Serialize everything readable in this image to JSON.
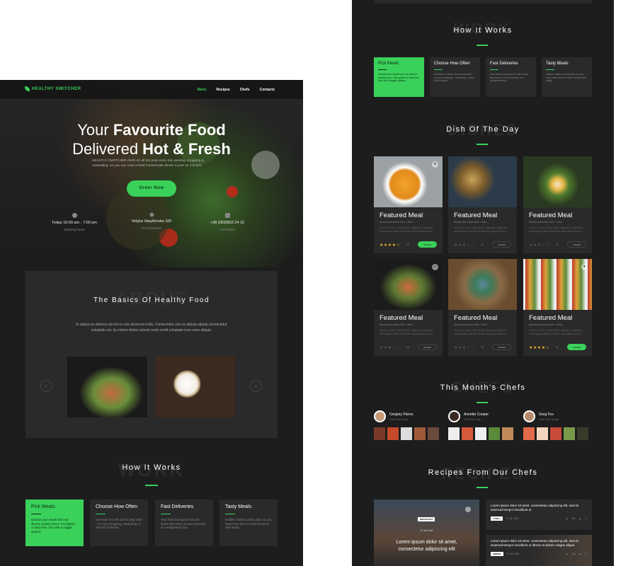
{
  "brand": {
    "name": "HEALTHY SWITCHER",
    "accent": "#3ad15a"
  },
  "nav": {
    "items": [
      "Menu",
      "Recipes",
      "Chefs",
      "Contacts"
    ],
    "active": "Menu"
  },
  "hero": {
    "line1_normal": "Your ",
    "line1_bold": "Favourite Food",
    "line2_normal": "Delivered ",
    "line2_bold": "Hot & Fresh",
    "text": "HEALTHY SWITCHER chefs do all the prep work, like peeling, chopping & marinating, so you can cook a fresh homemade dinner in just 15 minutes.",
    "button": "Order Now",
    "info": [
      {
        "icon": "clock-icon",
        "title": "Today 10:00 am - 7:00 pm",
        "sub": "Working hours"
      },
      {
        "icon": "location-icon",
        "title": "Velyka Vasylkivska 100",
        "sub": "Get Directions"
      },
      {
        "icon": "phone-icon",
        "title": "+38 (063)833 24 15",
        "sub": "Call Online"
      }
    ]
  },
  "about": {
    "bg_word": "ABOUT",
    "title": "The Basics Of Healthy Food",
    "text": "In aliqua ea ullamco ad est ex non deserunt nulla. Consectetur sint ea aliquip aliquip consectetur voluptate est. Eu minim dolore laboris enim mollit voluptate irure esse aliquip."
  },
  "how": {
    "bg_word": "WORK",
    "title": "How It Works",
    "cards": [
      {
        "title": "Pick Meals",
        "text": "Choose your meals from our diverse weekly menu. Find gluten or dairy free, low carb & veggie options.",
        "active": true
      },
      {
        "title": "Choose How Often",
        "text": "Our team of chefs do the prep work - no more chopping, measuring, or sink-full of dishes!",
        "active": false
      },
      {
        "title": "Fast Deliveries",
        "text": "Your fresh & prepared 15 min dinner kits arrive on your doorstep in a refrigerated box.",
        "active": false
      },
      {
        "title": "Tasty Meals",
        "text": "Gobble makes cooking fast, so you have more time to unwind and be with family.",
        "active": false
      }
    ]
  },
  "dishes": {
    "bg_word": "DISHES",
    "title": "Dish Of The Day",
    "items": [
      {
        "title": "Featured Meal",
        "sub": "Served with french fries + drink",
        "text": "Choice of: Coke, Fanta, Sprite, Upgrade to large fries, Add whopper patty, Add Tender crisp patty and more...",
        "rating": "★★★★☆",
        "count": "13",
        "order": "ORDER",
        "green": true
      },
      {
        "title": "Featured Meal",
        "sub": "Served with french fries + drink",
        "text": "Choice of: Coke, Fanta, Sprite, Upgrade to large fries, Add whopper patty, Add Tender crisp patty and more...",
        "rating": "★★★☆☆",
        "count": "13",
        "order": "ORDER",
        "green": false
      },
      {
        "title": "Featured Meal",
        "sub": "Served with french fries + drink",
        "text": "Choice of: Coke, Fanta, Sprite, Upgrade to large fries, Add whopper patty, Add Tender crisp patty and more...",
        "rating": "★★★☆☆",
        "count": "13",
        "order": "ORDER",
        "green": false
      },
      {
        "title": "Featured Meal",
        "sub": "Served with french fries + drink",
        "text": "Choice of: Coke, Fanta, Sprite, Upgrade to large fries, Add whopper patty, Add Tender crisp patty and more...",
        "rating": "★★★☆☆",
        "count": "13",
        "order": "ORDER",
        "green": false
      },
      {
        "title": "Featured Meal",
        "sub": "Served with french fries + drink",
        "text": "Choice of: Coke, Fanta, Sprite, Upgrade to large fries, Add whopper patty, Add Tender crisp patty and more...",
        "rating": "★★★☆☆",
        "count": "13",
        "order": "ORDER",
        "green": false
      },
      {
        "title": "Featured Meal",
        "sub": "Served with french fries + drink",
        "text": "Choice of: Coke, Fanta, Sprite, Upgrade to large fries, Add whopper patty, Add Tender crisp patty and more...",
        "rating": "★★★★☆",
        "count": "11",
        "order": "ORDER",
        "green": true
      }
    ]
  },
  "chefs": {
    "bg_word": "CHEFS",
    "title": "This Month's Chefs",
    "items": [
      {
        "name": "Gregory Flores",
        "role": "Chef of the week"
      },
      {
        "name": "Annette Cooper",
        "role": "Chef of the day"
      },
      {
        "name": "Greg Fox",
        "role": "Chef of the month"
      }
    ]
  },
  "recipes": {
    "bg_word": "RECIPES",
    "title": "Recipes From Our Chefs",
    "big": {
      "tag": "BREAKFAST",
      "date": "27 Jan 2018",
      "title": "Lorem ipsum dolor sit amet, consectetur adipiscing elit"
    },
    "small": [
      {
        "title": "Lorem ipsum dolor sit amet, consectetur adipiscing elit, sed do eiusmod tempor incididunt ut",
        "tag": "LUNCH",
        "date": "27 Jan 2018",
        "views": "105",
        "comments": "11"
      },
      {
        "title": "Lorem ipsum dolor sit amet, consectetur adipiscing elit, sed do eiusmod tempor incididunt ut labore et dolore magna aliqua",
        "tag": "DINNER",
        "date": "27 Jan 2018",
        "views": "105",
        "comments": "11"
      }
    ]
  }
}
